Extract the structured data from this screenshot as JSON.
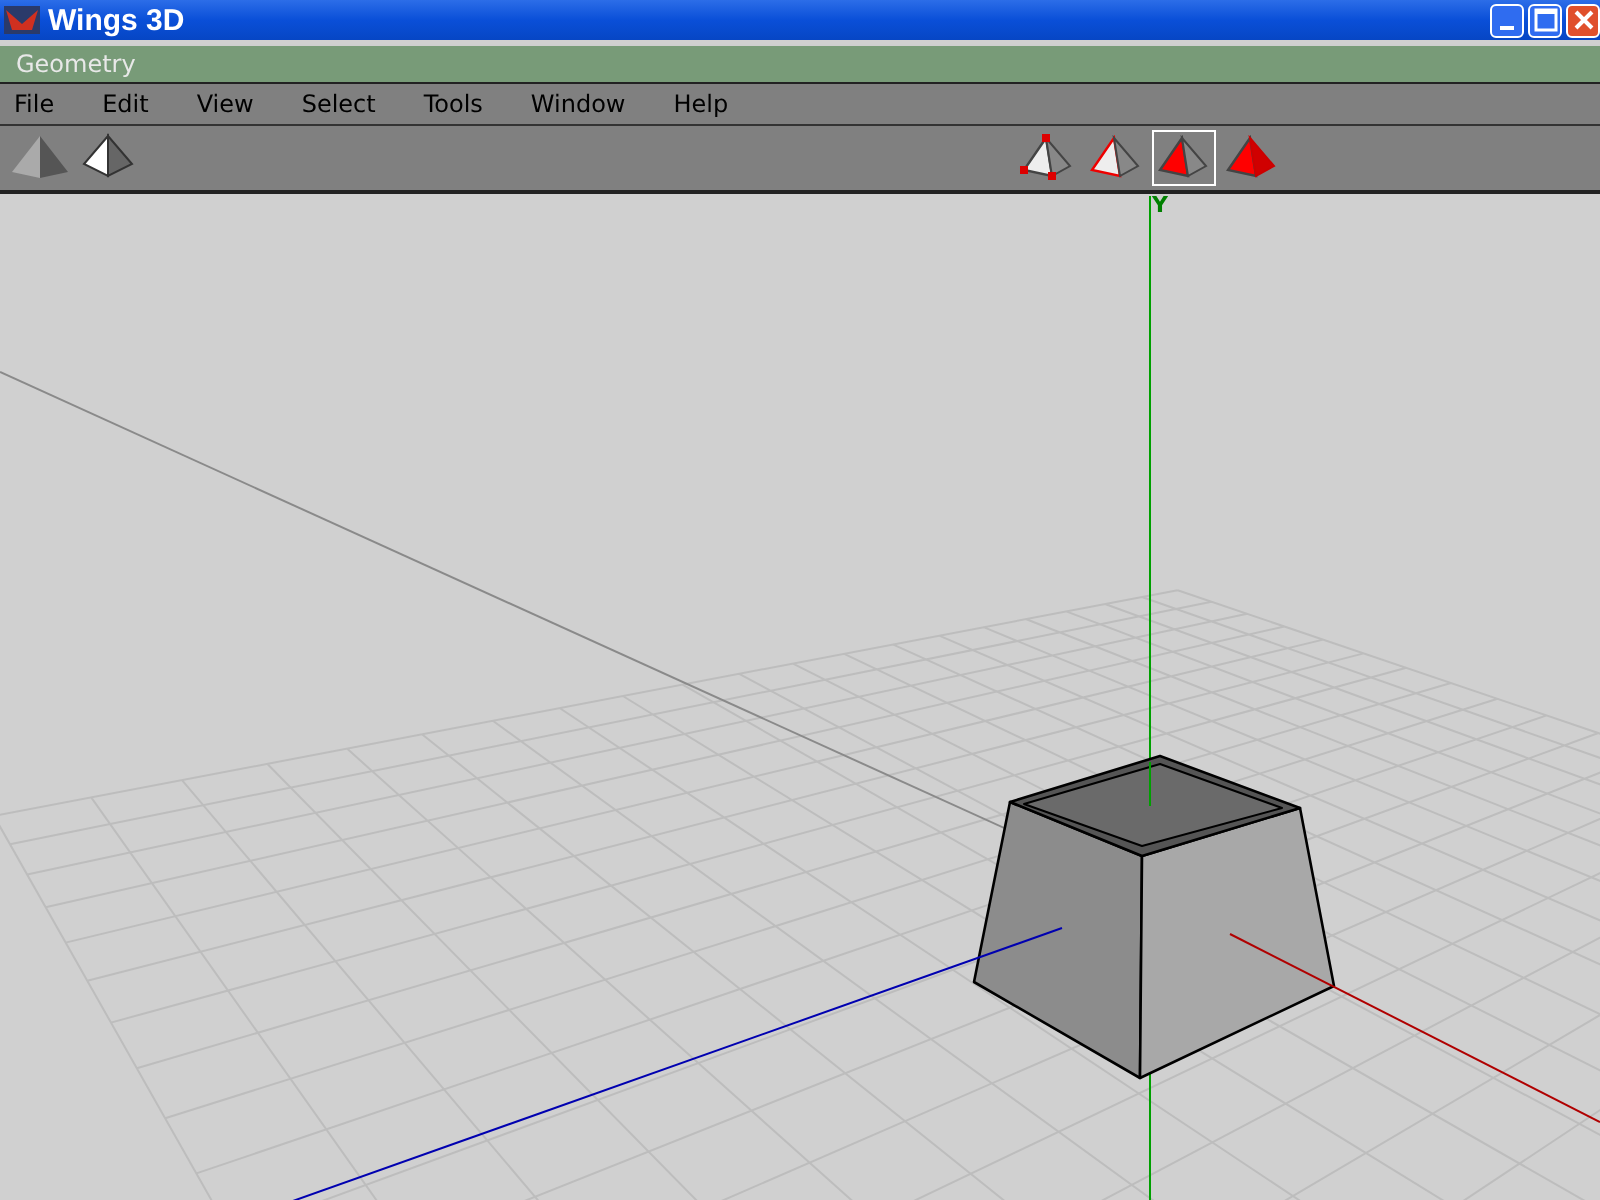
{
  "window": {
    "title": "Wings 3D"
  },
  "geometry_bar": {
    "title": "Geometry"
  },
  "menu": [
    "File",
    "Edit",
    "View",
    "Select",
    "Tools",
    "Window",
    "Help"
  ],
  "selection_modes": [
    {
      "kind": "vertex",
      "selected": false
    },
    {
      "kind": "edge",
      "selected": false
    },
    {
      "kind": "face",
      "selected": true
    },
    {
      "kind": "body",
      "selected": false
    }
  ],
  "viewport": {
    "axis_label": "Y"
  }
}
